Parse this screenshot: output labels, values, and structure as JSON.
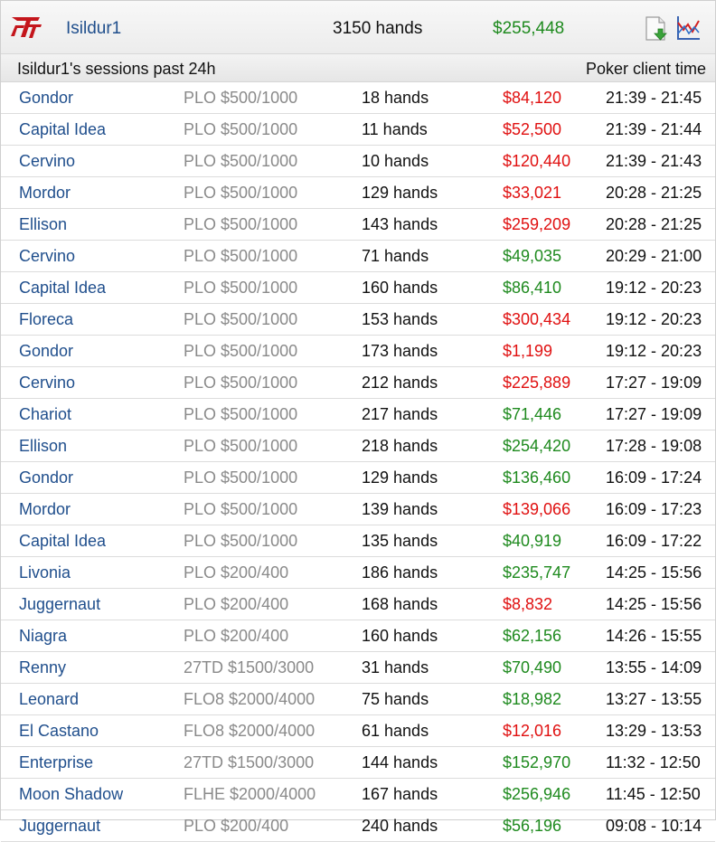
{
  "header": {
    "player_name": "Isildur1",
    "total_hands": "3150 hands",
    "total_profit": "$255,448",
    "total_profit_sign": "positive",
    "logo_icon": "full-tilt-logo-icon",
    "export_icon": "export-document-icon",
    "graph_icon": "profit-graph-icon"
  },
  "subheader": {
    "title": "Isildur1's sessions past 24h",
    "time_label": "Poker client time"
  },
  "colors": {
    "loss": "#e01010",
    "win": "#1e8a1e",
    "table_name": "#1f4e8c",
    "game": "#8a8a8a"
  },
  "sessions": [
    {
      "table": "Gondor",
      "game": "PLO $500/1000",
      "hands": "18 hands",
      "profit": "$84,120",
      "sign": "neg",
      "time": "21:39 - 21:45"
    },
    {
      "table": "Capital Idea",
      "game": "PLO $500/1000",
      "hands": "11 hands",
      "profit": "$52,500",
      "sign": "neg",
      "time": "21:39 - 21:44"
    },
    {
      "table": "Cervino",
      "game": "PLO $500/1000",
      "hands": "10 hands",
      "profit": "$120,440",
      "sign": "neg",
      "time": "21:39 - 21:43"
    },
    {
      "table": "Mordor",
      "game": "PLO $500/1000",
      "hands": "129 hands",
      "profit": "$33,021",
      "sign": "neg",
      "time": "20:28 - 21:25"
    },
    {
      "table": "Ellison",
      "game": "PLO $500/1000",
      "hands": "143 hands",
      "profit": "$259,209",
      "sign": "neg",
      "time": "20:28 - 21:25"
    },
    {
      "table": "Cervino",
      "game": "PLO $500/1000",
      "hands": "71 hands",
      "profit": "$49,035",
      "sign": "pos",
      "time": "20:29 - 21:00"
    },
    {
      "table": "Capital Idea",
      "game": "PLO $500/1000",
      "hands": "160 hands",
      "profit": "$86,410",
      "sign": "pos",
      "time": "19:12 - 20:23"
    },
    {
      "table": "Floreca",
      "game": "PLO $500/1000",
      "hands": "153 hands",
      "profit": "$300,434",
      "sign": "neg",
      "time": "19:12 - 20:23"
    },
    {
      "table": "Gondor",
      "game": "PLO $500/1000",
      "hands": "173 hands",
      "profit": "$1,199",
      "sign": "neg",
      "time": "19:12 - 20:23"
    },
    {
      "table": "Cervino",
      "game": "PLO $500/1000",
      "hands": "212 hands",
      "profit": "$225,889",
      "sign": "neg",
      "time": "17:27 - 19:09"
    },
    {
      "table": "Chariot",
      "game": "PLO $500/1000",
      "hands": "217 hands",
      "profit": "$71,446",
      "sign": "pos",
      "time": "17:27 - 19:09"
    },
    {
      "table": "Ellison",
      "game": "PLO $500/1000",
      "hands": "218 hands",
      "profit": "$254,420",
      "sign": "pos",
      "time": "17:28 - 19:08"
    },
    {
      "table": "Gondor",
      "game": "PLO $500/1000",
      "hands": "129 hands",
      "profit": "$136,460",
      "sign": "pos",
      "time": "16:09 - 17:24"
    },
    {
      "table": "Mordor",
      "game": "PLO $500/1000",
      "hands": "139 hands",
      "profit": "$139,066",
      "sign": "neg",
      "time": "16:09 - 17:23"
    },
    {
      "table": "Capital Idea",
      "game": "PLO $500/1000",
      "hands": "135 hands",
      "profit": "$40,919",
      "sign": "pos",
      "time": "16:09 - 17:22"
    },
    {
      "table": "Livonia",
      "game": "PLO $200/400",
      "hands": "186 hands",
      "profit": "$235,747",
      "sign": "pos",
      "time": "14:25 - 15:56"
    },
    {
      "table": "Juggernaut",
      "game": "PLO $200/400",
      "hands": "168 hands",
      "profit": "$8,832",
      "sign": "neg",
      "time": "14:25 - 15:56"
    },
    {
      "table": "Niagra",
      "game": "PLO $200/400",
      "hands": "160 hands",
      "profit": "$62,156",
      "sign": "pos",
      "time": "14:26 - 15:55"
    },
    {
      "table": "Renny",
      "game": "27TD $1500/3000",
      "hands": "31 hands",
      "profit": "$70,490",
      "sign": "pos",
      "time": "13:55 - 14:09"
    },
    {
      "table": "Leonard",
      "game": "FLO8 $2000/4000",
      "hands": "75 hands",
      "profit": "$18,982",
      "sign": "pos",
      "time": "13:27 - 13:55"
    },
    {
      "table": "El Castano",
      "game": "FLO8 $2000/4000",
      "hands": "61 hands",
      "profit": "$12,016",
      "sign": "neg",
      "time": "13:29 - 13:53"
    },
    {
      "table": "Enterprise",
      "game": "27TD $1500/3000",
      "hands": "144 hands",
      "profit": "$152,970",
      "sign": "pos",
      "time": "11:32 - 12:50"
    },
    {
      "table": "Moon Shadow",
      "game": "FLHE $2000/4000",
      "hands": "167 hands",
      "profit": "$256,946",
      "sign": "pos",
      "time": "11:45 - 12:50"
    },
    {
      "table": "Juggernaut",
      "game": "PLO $200/400",
      "hands": "240 hands",
      "profit": "$56,196",
      "sign": "pos",
      "time": "09:08 - 10:14"
    }
  ]
}
